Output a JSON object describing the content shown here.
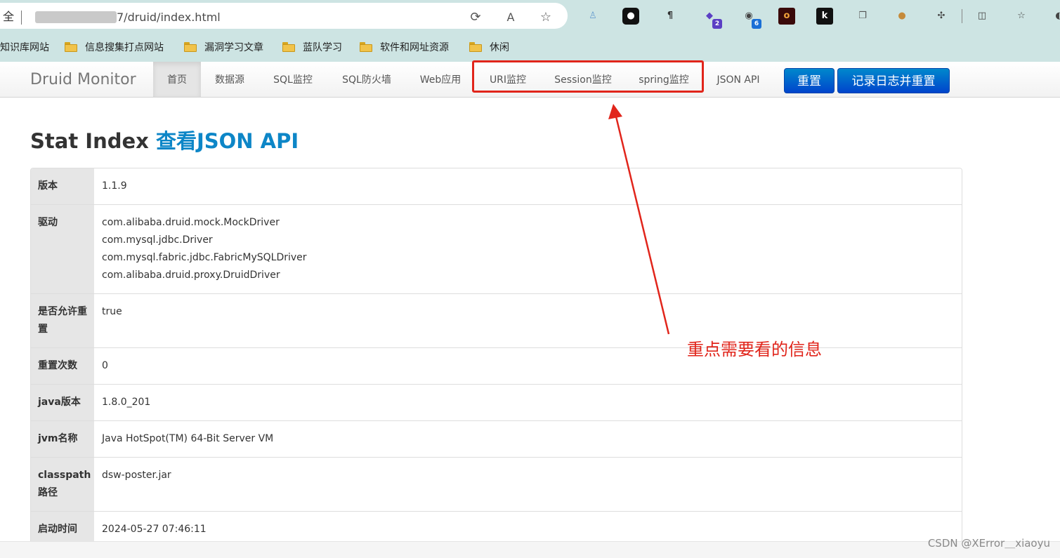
{
  "browser": {
    "security_fragment": "全",
    "url_visible": "7/druid/index.html",
    "toolbar_icons": [
      "refresh-icon",
      "read-aloud-icon",
      "favorite-star-icon"
    ],
    "extensions": [
      {
        "name": "ext-person-icon",
        "glyph": "♙",
        "color": "#6a9fd0",
        "badge": ""
      },
      {
        "name": "ext-mask-icon",
        "glyph": "●",
        "color": "#111",
        "badge": ""
      },
      {
        "name": "ext-paragraph-icon",
        "glyph": "¶",
        "color": "#333",
        "badge": ""
      },
      {
        "name": "ext-cap-icon",
        "glyph": "◆",
        "color": "#5b3fc4",
        "badge": "2"
      },
      {
        "name": "ext-panda-icon",
        "glyph": "◉",
        "color": "#444",
        "badge": "6"
      },
      {
        "name": "ext-o-icon",
        "glyph": "o",
        "color": "#b02020",
        "badge": ""
      },
      {
        "name": "ext-k-icon",
        "glyph": "k",
        "color": "#fff",
        "badge": ""
      },
      {
        "name": "ext-copy-icon",
        "glyph": "❐",
        "color": "#555",
        "badge": ""
      },
      {
        "name": "ext-cookie-icon",
        "glyph": "●",
        "color": "#c58a3a",
        "badge": ""
      },
      {
        "name": "extensions-puzzle-icon",
        "glyph": "✣",
        "color": "#444",
        "badge": ""
      },
      {
        "name": "split-screen-icon",
        "glyph": "◫",
        "color": "#444",
        "badge": ""
      },
      {
        "name": "favorites-icon",
        "glyph": "☆",
        "color": "#444",
        "badge": ""
      },
      {
        "name": "edge-icon",
        "glyph": "◐",
        "color": "#444",
        "badge": ""
      }
    ],
    "bookmarks": [
      {
        "label": "知识库网站",
        "folder": false
      },
      {
        "label": "信息搜集打点网站",
        "folder": true
      },
      {
        "label": "漏洞学习文章",
        "folder": true
      },
      {
        "label": "蓝队学习",
        "folder": true
      },
      {
        "label": "软件和网址资源",
        "folder": true
      },
      {
        "label": "休闲",
        "folder": true
      }
    ]
  },
  "nav": {
    "brand": "Druid Monitor",
    "links": [
      "首页",
      "数据源",
      "SQL监控",
      "SQL防火墙",
      "Web应用",
      "URI监控",
      "Session监控",
      "spring监控",
      "JSON API"
    ],
    "active_index": 0,
    "reset_button": "重置",
    "log_reset_button": "记录日志并重置"
  },
  "page": {
    "title": "Stat Index ",
    "title_link": "查看JSON API"
  },
  "stat": [
    {
      "label": "版本",
      "values": [
        "1.1.9"
      ]
    },
    {
      "label": "驱动",
      "values": [
        "com.alibaba.druid.mock.MockDriver",
        "com.mysql.jdbc.Driver",
        "com.mysql.fabric.jdbc.FabricMySQLDriver",
        "com.alibaba.druid.proxy.DruidDriver"
      ]
    },
    {
      "label": "是否允许重置",
      "values": [
        "true"
      ]
    },
    {
      "label": "重置次数",
      "values": [
        "0"
      ]
    },
    {
      "label": "java版本",
      "values": [
        "1.8.0_201"
      ]
    },
    {
      "label": "jvm名称",
      "values": [
        "Java HotSpot(TM) 64-Bit Server VM"
      ]
    },
    {
      "label": "classpath路径",
      "values": [
        "dsw-poster.jar"
      ]
    },
    {
      "label": "启动时间",
      "values": [
        "2024-05-27 07:46:11"
      ]
    }
  ],
  "annotation": {
    "text": "重点需要看的信息",
    "color": "#e1251b"
  },
  "watermark": "CSDN @XError＿xiaoyu"
}
